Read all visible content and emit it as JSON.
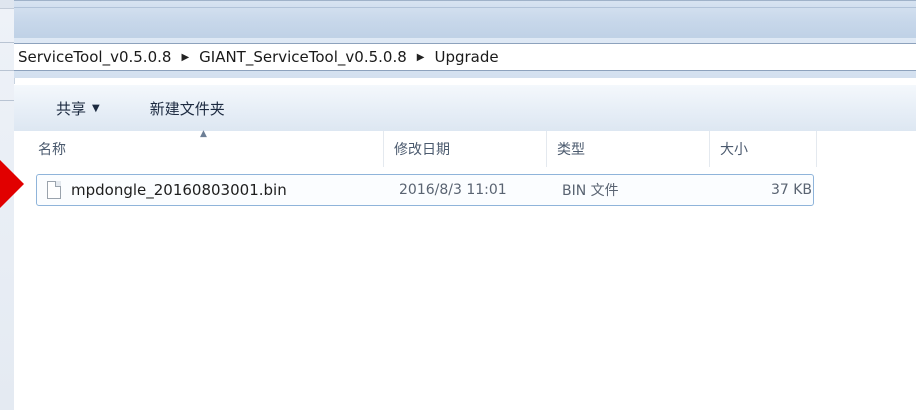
{
  "address_bar": {
    "crumbs": [
      "ServiceTool_v0.5.0.8",
      "GIANT_ServiceTool_v0.5.0.8",
      "Upgrade"
    ]
  },
  "toolbar": {
    "share_label": "共享",
    "new_folder_label": "新建文件夹"
  },
  "columns": {
    "name": "名称",
    "date_modified": "修改日期",
    "type": "类型",
    "size": "大小"
  },
  "files": [
    {
      "name": "mpdongle_20160803001.bin",
      "date_modified": "2016/8/3 11:01",
      "type": "BIN 文件",
      "size": "37 KB"
    }
  ],
  "colors": {
    "marker": "#e10000",
    "selection_border": "#8fb4da"
  }
}
